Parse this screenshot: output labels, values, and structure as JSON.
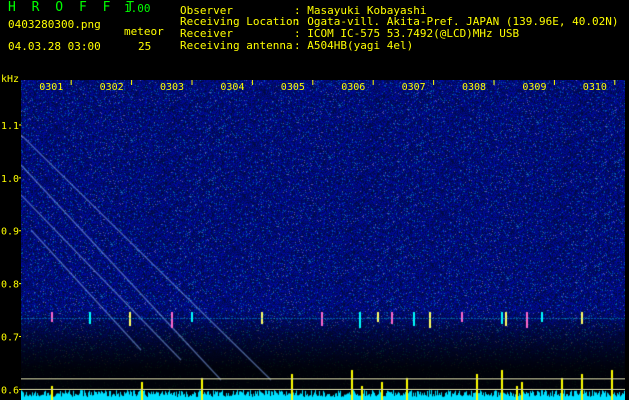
{
  "header": {
    "app_title": "H R O F F T",
    "app_version": "1.00",
    "file_name": "0403280300.png",
    "meteor_label": "meteor",
    "date_time": "04.03.28 03:00",
    "meteor_count": "25"
  },
  "station": [
    {
      "label": "Observer",
      "value": ": Masayuki Kobayashi"
    },
    {
      "label": "Receiving Location",
      "value": ": Ogata-vill. Akita-Pref. JAPAN (139.96E, 40.02N)"
    },
    {
      "label": "Receiver",
      "value": ": ICOM IC-575 53.7492(@LCD)MHz USB"
    },
    {
      "label": "Receiving antenna",
      "value": ": A504HB(yagi 4el)"
    }
  ],
  "chart_data": {
    "type": "heatmap",
    "ylabel": "kHz",
    "x_ticks": [
      "0301",
      "0302",
      "0303",
      "0304",
      "0305",
      "0306",
      "0307",
      "0308",
      "0309",
      "0310"
    ],
    "y_ticks": [
      "1.1",
      "1.0",
      "0.9",
      "0.8",
      "0.7",
      "0.6"
    ],
    "ylim": [
      0.58,
      1.185
    ],
    "xlim": [
      0.5,
      10.5
    ],
    "reference_lines_khz": [
      0.62,
      0.6
    ],
    "colors": {
      "axis_text": "#ffff00",
      "title": "#00ff00",
      "background": "#000080",
      "pings": "#ff66cc",
      "activity": "#00ffff"
    }
  }
}
